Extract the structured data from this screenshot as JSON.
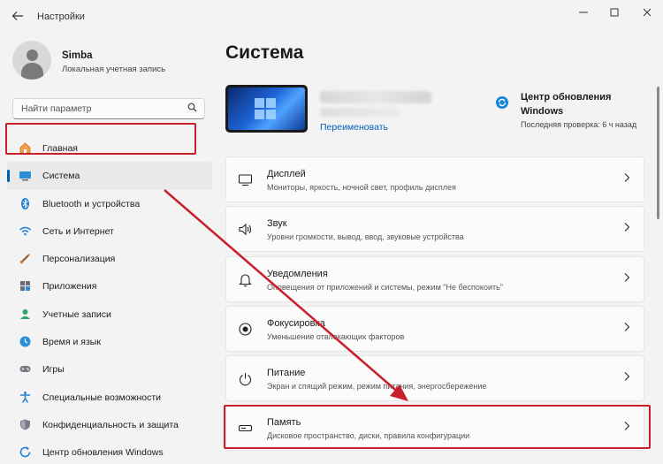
{
  "window": {
    "title": "Настройки",
    "back_icon": "back-arrow-icon",
    "controls": [
      "minimize-icon",
      "maximize-icon",
      "close-icon"
    ]
  },
  "user": {
    "name": "Simba",
    "account_type": "Локальная учетная запись"
  },
  "search": {
    "placeholder": "Найти параметр"
  },
  "sidebar": {
    "items": [
      {
        "label": "Главная",
        "icon": "home-icon"
      },
      {
        "label": "Система",
        "icon": "system-icon",
        "active": true
      },
      {
        "label": "Bluetooth и устройства",
        "icon": "bluetooth-icon"
      },
      {
        "label": "Сеть и Интернет",
        "icon": "wifi-icon"
      },
      {
        "label": "Персонализация",
        "icon": "brush-icon"
      },
      {
        "label": "Приложения",
        "icon": "apps-icon"
      },
      {
        "label": "Учетные записи",
        "icon": "account-icon"
      },
      {
        "label": "Время и язык",
        "icon": "time-language-icon"
      },
      {
        "label": "Игры",
        "icon": "gamepad-icon"
      },
      {
        "label": "Специальные возможности",
        "icon": "accessibility-icon"
      },
      {
        "label": "Конфиденциальность и защита",
        "icon": "shield-icon"
      },
      {
        "label": "Центр обновления Windows",
        "icon": "update-icon"
      }
    ]
  },
  "main": {
    "title": "Система",
    "device": {
      "rename_label": "Переименовать"
    },
    "windows_update": {
      "title": "Центр обновления Windows",
      "subtitle": "Последняя проверка: 6 ч назад"
    },
    "cards": [
      {
        "title": "Дисплей",
        "subtitle": "Мониторы, яркость, ночной свет, профиль дисплея",
        "icon": "display-icon"
      },
      {
        "title": "Звук",
        "subtitle": "Уровни громкости, вывод, ввод, звуковые устройства",
        "icon": "speaker-icon"
      },
      {
        "title": "Уведомления",
        "subtitle": "Оповещения от приложений и системы, режим \"Не беспокоить\"",
        "icon": "bell-icon"
      },
      {
        "title": "Фокусировка",
        "subtitle": "Уменьшение отвлекающих факторов",
        "icon": "focus-icon"
      },
      {
        "title": "Питание",
        "subtitle": "Экран и спящий режим, режим питания, энергосбережение",
        "icon": "power-icon"
      },
      {
        "title": "Память",
        "subtitle": "Дисковое пространство, диски, правила конфигурации",
        "icon": "storage-icon"
      }
    ]
  },
  "colors": {
    "accent": "#005fb8",
    "highlight": "#c8202a"
  }
}
